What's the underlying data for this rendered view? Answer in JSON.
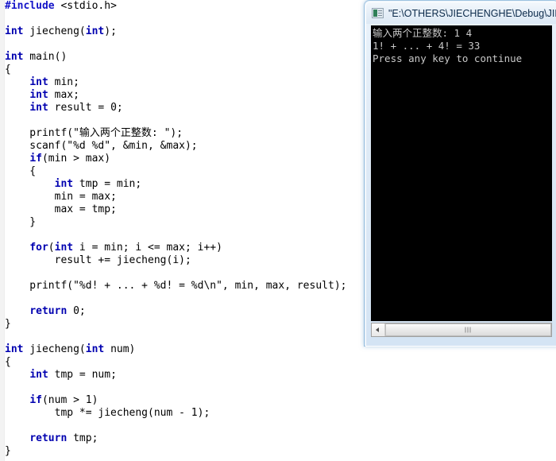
{
  "editor": {
    "name": "code-editor",
    "language": "C",
    "background_color": "#ffffff",
    "keyword_color": "#0000b0",
    "text_color": "#000000",
    "lines": [
      {
        "id": "l1",
        "html": "<span class='pp'>#include</span> &lt;stdio.h&gt;"
      },
      {
        "id": "l2",
        "html": ""
      },
      {
        "id": "l3",
        "html": "<span class='kw'>int</span> jiecheng(<span class='kw'>int</span>);"
      },
      {
        "id": "l4",
        "html": ""
      },
      {
        "id": "l5",
        "html": "<span class='kw'>int</span> main()"
      },
      {
        "id": "l6",
        "html": "{"
      },
      {
        "id": "l7",
        "html": "    <span class='kw'>int</span> min;"
      },
      {
        "id": "l8",
        "html": "    <span class='kw'>int</span> max;"
      },
      {
        "id": "l9",
        "html": "    <span class='kw'>int</span> result = 0;"
      },
      {
        "id": "l10",
        "html": ""
      },
      {
        "id": "l11",
        "html": "    printf(\"输入两个正整数: \");"
      },
      {
        "id": "l12",
        "html": "    scanf(\"%d %d\", &amp;min, &amp;max);"
      },
      {
        "id": "l13",
        "html": "    <span class='kw'>if</span>(min &gt; max)"
      },
      {
        "id": "l14",
        "html": "    {"
      },
      {
        "id": "l15",
        "html": "        <span class='kw'>int</span> tmp = min;"
      },
      {
        "id": "l16",
        "html": "        min = max;"
      },
      {
        "id": "l17",
        "html": "        max = tmp;"
      },
      {
        "id": "l18",
        "html": "    }"
      },
      {
        "id": "l19",
        "html": ""
      },
      {
        "id": "l20",
        "html": "    <span class='kw'>for</span>(<span class='kw'>int</span> i = min; i &lt;= max; i++)"
      },
      {
        "id": "l21",
        "html": "        result += jiecheng(i);"
      },
      {
        "id": "l22",
        "html": ""
      },
      {
        "id": "l23",
        "html": "    printf(\"%d! + ... + %d! = %d\\n\", min, max, result);"
      },
      {
        "id": "l24",
        "html": ""
      },
      {
        "id": "l25",
        "html": "    <span class='kw'>return</span> 0;"
      },
      {
        "id": "l26",
        "html": "}"
      },
      {
        "id": "l27",
        "html": ""
      },
      {
        "id": "l28",
        "html": "<span class='kw'>int</span> jiecheng(<span class='kw'>int</span> num)"
      },
      {
        "id": "l29",
        "html": "{"
      },
      {
        "id": "l30",
        "html": "    <span class='kw'>int</span> tmp = num;"
      },
      {
        "id": "l31",
        "html": ""
      },
      {
        "id": "l32",
        "html": "    <span class='kw'>if</span>(num &gt; 1)"
      },
      {
        "id": "l33",
        "html": "        tmp *= jiecheng(num - 1);"
      },
      {
        "id": "l34",
        "html": ""
      },
      {
        "id": "l35",
        "html": "    <span class='kw'>return</span> tmp;"
      },
      {
        "id": "l36",
        "html": "}"
      }
    ]
  },
  "console": {
    "title": "\"E:\\OTHERS\\JIECHENGHE\\Debug\\JIEC",
    "icon": "console-app-icon",
    "screen_background": "#000000",
    "screen_text_color": "#c8c8c8",
    "output_lines": [
      "输入两个正整数: 1 4",
      "1! + ... + 4! = 33",
      "Press any key to continue"
    ],
    "scrollbar": {
      "left_arrow_label": "◀",
      "grip_label": "grip"
    }
  }
}
